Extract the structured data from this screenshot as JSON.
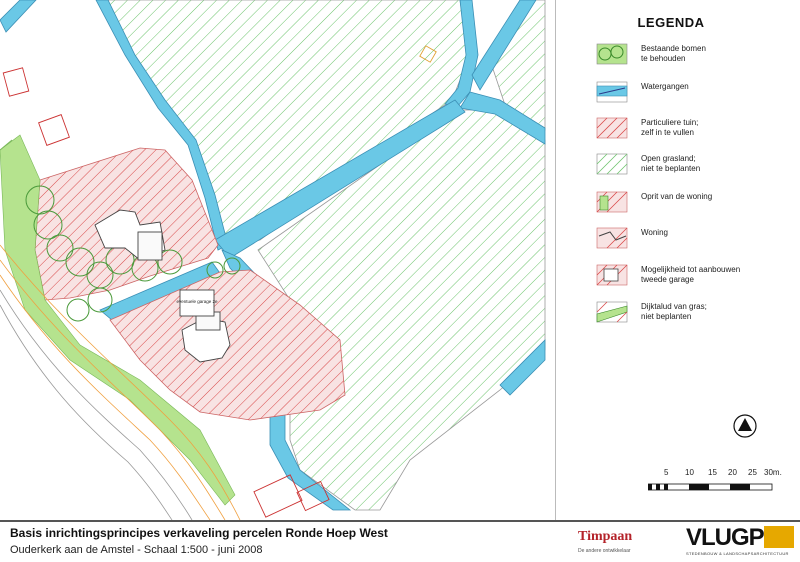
{
  "legend": {
    "title": "LEGENDA",
    "items": [
      {
        "label": "Bestaande bomen\nte behouden",
        "symbol": "trees-icon"
      },
      {
        "label": "Watergangen",
        "symbol": "water-icon"
      },
      {
        "label": "Particuliere tuin;\nzelf in te vullen",
        "symbol": "private-garden-icon"
      },
      {
        "label": "Open grasland;\nniet te beplanten",
        "symbol": "grassland-icon"
      },
      {
        "label": "Oprit van de woning",
        "symbol": "driveway-icon"
      },
      {
        "label": "Woning",
        "symbol": "house-icon"
      },
      {
        "label": "Mogelijkheid tot aanbouwen\ntweede garage",
        "symbol": "garage-icon"
      },
      {
        "label": "Dijktalud van gras;\nniet beplanten",
        "symbol": "dike-slope-icon"
      }
    ]
  },
  "scale_bar": {
    "ticks": [
      "5",
      "10",
      "15",
      "20",
      "25",
      "30m."
    ]
  },
  "map_labels": {
    "garage": "eventuele garage 2e"
  },
  "footer": {
    "title": "Basis inrichtingsprincipes verkaveling percelen Ronde Hoep West",
    "subtitle": "Ouderkerk aan de Amstel - Schaal 1:500 - juni 2008"
  },
  "logos": {
    "timpaan": "Timpaan",
    "timpaan_tagline": "De andere ontwikkelaar",
    "vlugp": "VLUGP",
    "vlugp_tagline": "STEDENBOUW & LANDSCHAPSARCHITECTUUR"
  },
  "colors": {
    "water": "#6ac8e6",
    "water_outline": "#1f6f9a",
    "grass_hatch": "#78c878",
    "garden_hatch": "#e05050",
    "garden_fill": "#f6dede",
    "dike_green": "#b0e28a",
    "road_orange": "#f0a040"
  }
}
